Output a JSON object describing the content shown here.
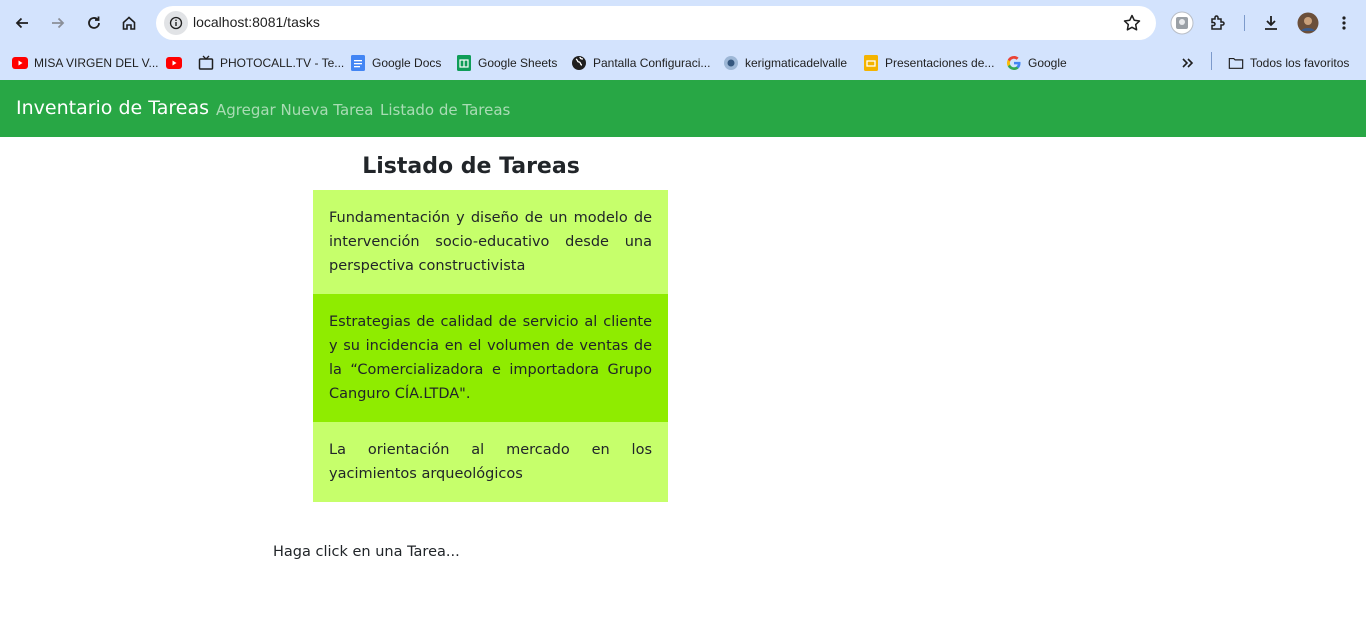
{
  "browser": {
    "url": "localhost:8081/tasks",
    "bookmarks": [
      {
        "label": "MISA VIRGEN DEL V...",
        "icon": "youtube-icon"
      },
      {
        "label": "",
        "icon": "youtube-icon"
      },
      {
        "label": "PHOTOCALL.TV - Te...",
        "icon": "tv-icon"
      },
      {
        "label": "Google Docs",
        "icon": "docs-icon"
      },
      {
        "label": "Google Sheets",
        "icon": "sheets-icon"
      },
      {
        "label": "Pantalla Configuraci...",
        "icon": "globe-icon"
      },
      {
        "label": "kerigmaticadelvalle",
        "icon": "site-icon"
      },
      {
        "label": "Presentaciones de...",
        "icon": "slides-icon"
      },
      {
        "label": "Google",
        "icon": "google-icon"
      }
    ],
    "all_bookmarks_label": "Todos los favoritos"
  },
  "navbar": {
    "brand": "Inventario de Tareas",
    "links": [
      "Agregar Nueva Tarea",
      "Listado de Tareas"
    ]
  },
  "main": {
    "title": "Listado de Tareas",
    "tasks": [
      "Fundamentación y diseño de un modelo de intervención socio-educativo desde una perspectiva constructivista",
      "Estrategias de calidad de servicio al cliente y su incidencia en el volumen de ventas de la “Comercializadora e importadora Grupo Canguro CÍA.LTDA\".",
      "La orientación al mercado en los yacimientos arqueológicos"
    ],
    "hint": "Haga click en una Tarea..."
  },
  "colors": {
    "navbar": "#28a745",
    "task_light": "#c6ff6b",
    "task_active": "#8fec00"
  }
}
